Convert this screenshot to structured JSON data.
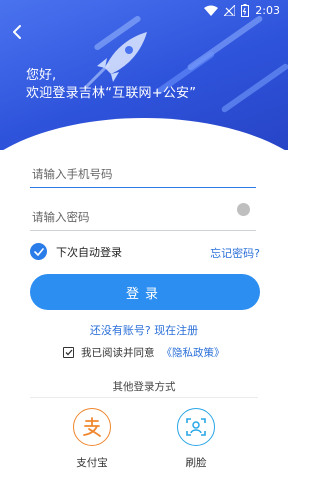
{
  "status_bar": {
    "time": "2:03",
    "icons": [
      "wifi-icon",
      "signal-off-icon",
      "battery-icon"
    ]
  },
  "header": {
    "back_icon": "back-arrow-icon",
    "greeting": "您好,",
    "welcome": "欢迎登录吉林“互联网+公安”"
  },
  "form": {
    "phone_placeholder": "请输入手机号码",
    "password_placeholder": "请输入密码",
    "auto_login_label": "下次自动登录",
    "auto_login_checked": true,
    "forgot_password": "忘记密码?",
    "login_button": "登录",
    "register_link": "还没有账号? 现在注册",
    "agree_text": "我已阅读并同意",
    "privacy_link": "《隐私政策》",
    "agree_checked": true
  },
  "other_login": {
    "title": "其他登录方式",
    "methods": [
      {
        "label": "支付宝",
        "icon": "alipay-icon"
      },
      {
        "label": "刷脸",
        "icon": "face-scan-icon"
      }
    ]
  },
  "colors": {
    "header_gradient_start": "#4a73ef",
    "header_gradient_end": "#2744c6",
    "accent": "#2b8ef0",
    "link": "#2b6fd8",
    "alipay": "#f0872f",
    "face": "#28a6e6"
  }
}
